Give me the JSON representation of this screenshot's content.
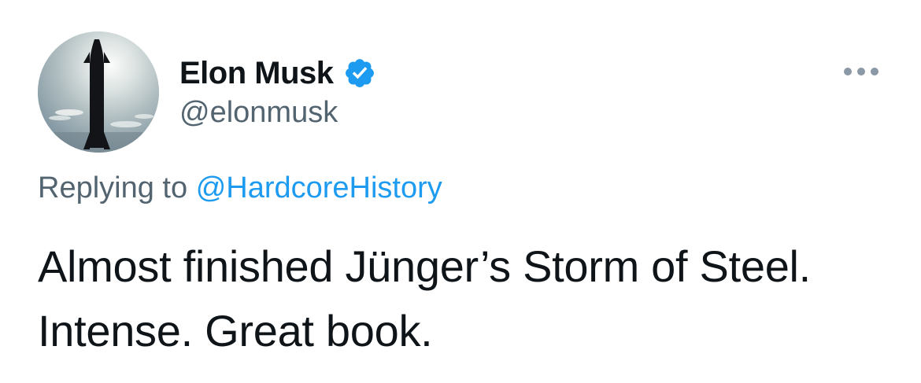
{
  "author": {
    "display_name": "Elon Musk",
    "handle": "@elonmusk",
    "verified": true,
    "verified_badge_color": "#1d9bf0"
  },
  "reply": {
    "prefix": "Replying to",
    "mention": "@HardcoreHistory",
    "mention_color": "#1d9bf0"
  },
  "tweet": {
    "text": "Almost finished Jünger’s Storm of Steel. Intense. Great book."
  },
  "icons": {
    "more": "more-horizontal-icon",
    "verified": "verified-badge-icon"
  }
}
